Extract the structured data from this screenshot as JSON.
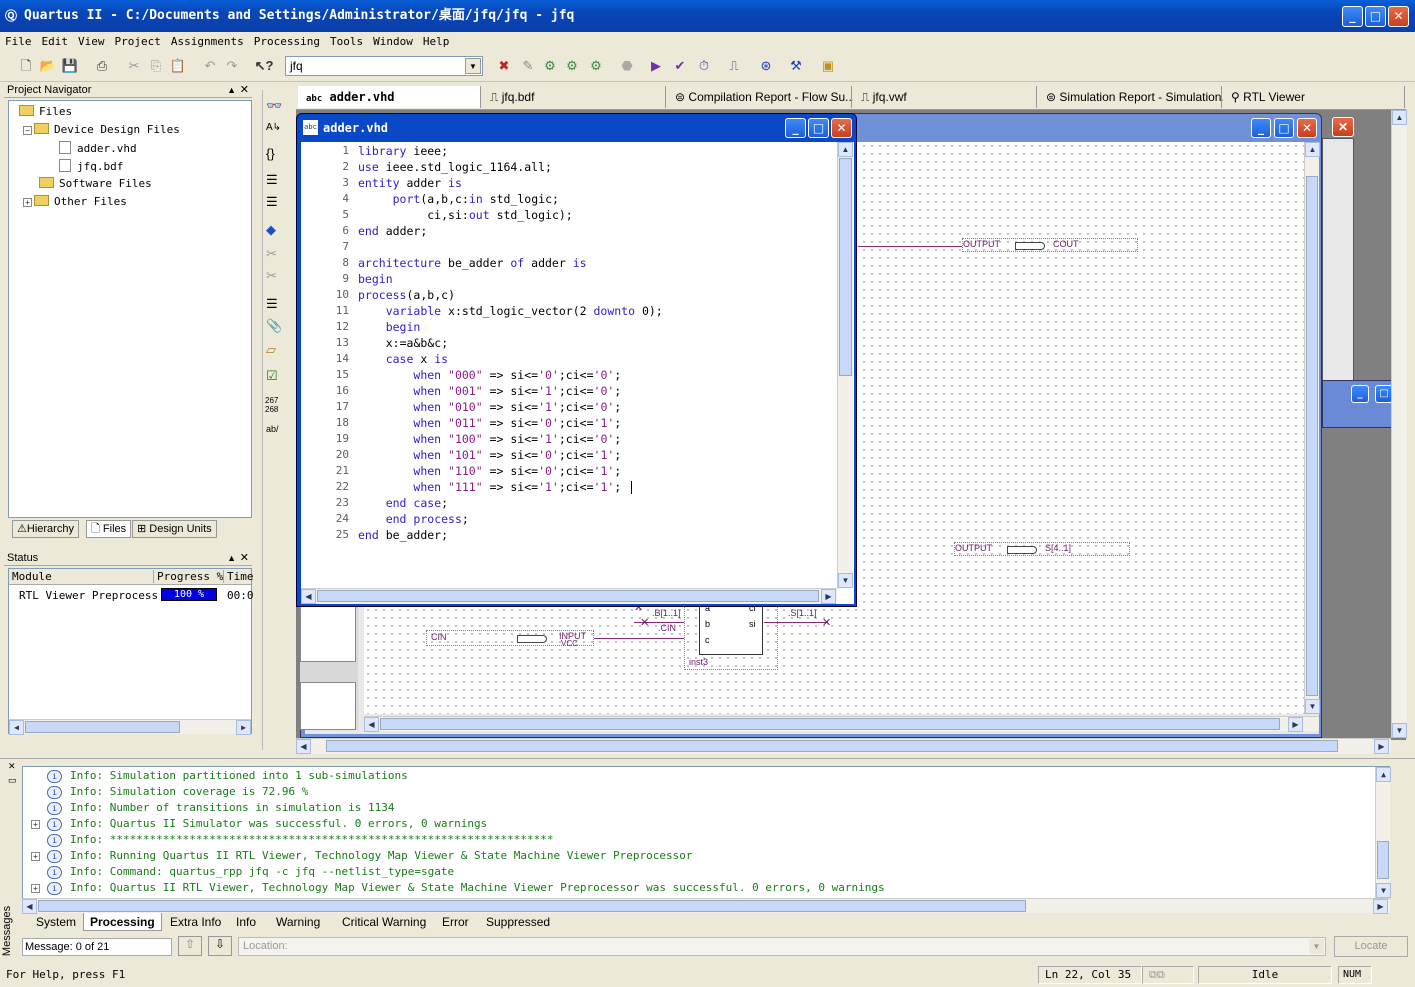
{
  "window": {
    "title": "Quartus II - C:/Documents and Settings/Administrator/桌面/jfq/jfq - jfq"
  },
  "menu": [
    "File",
    "Edit",
    "View",
    "Project",
    "Assignments",
    "Processing",
    "Tools",
    "Window",
    "Help"
  ],
  "toolbar": {
    "combo_value": "jfq"
  },
  "navigator": {
    "title": "Project Navigator",
    "tree": [
      "Files",
      "Device Design Files",
      "adder.vhd",
      "jfq.bdf",
      "Software Files",
      "Other Files"
    ],
    "tabs": [
      "Hierarchy",
      "Files",
      "Design Units"
    ]
  },
  "status_panel": {
    "title": "Status",
    "headers": [
      "Module",
      "Progress %",
      "Time"
    ],
    "row": {
      "module": "RTL Viewer Preprocess",
      "progress": "100 %",
      "time": "00:0"
    }
  },
  "doc_tabs": [
    "adder.vhd",
    "jfq.bdf",
    "Compilation Report - Flow Su...",
    "jfq.vwf",
    "Simulation Report - Simulation...",
    "RTL Viewer"
  ],
  "editor": {
    "title": "adder.vhd",
    "lines": [
      "library ieee;",
      "use ieee.std_logic_1164.all;",
      "entity adder is",
      "     port(a,b,c:in std_logic;",
      "          ci,si:out std_logic);",
      "end adder;",
      "",
      "architecture be_adder of adder is",
      "begin",
      "process(a,b,c)",
      "    variable x:std_logic_vector(2 downto 0);",
      "    begin",
      "    x:=a&b&c;",
      "    case x is",
      "        when \"000\" => si<='0';ci<='0';",
      "        when \"001\" => si<='1';ci<='0';",
      "        when \"010\" => si<='1';ci<='0';",
      "        when \"011\" => si<='0';ci<='1';",
      "        when \"100\" => si<='1';ci<='0';",
      "        when \"101\" => si<='0';ci<='1';",
      "        when \"110\" => si<='0';ci<='1';",
      "        when \"111\" => si<='1';ci<='1';",
      "    end case;",
      "    end process;",
      "end be_adder;"
    ]
  },
  "schematic": {
    "output_cout": "OUTPUT",
    "cout": "COUT",
    "output_s": "OUTPUT",
    "s": "S[4..1]",
    "input_label": "INPUT",
    "vcc": "VCC",
    "cin": "CIN",
    "b_wire": ".B[1..1]",
    "cin_wire": ".CIN",
    "s_wire": ".S[1..1]",
    "pin_a": "a",
    "pin_b": "b",
    "pin_c": "c",
    "pin_ci": "ci",
    "pin_si": "si",
    "inst": "inst3"
  },
  "messages": {
    "lines": [
      "Info: Simulation partitioned into 1 sub-simulations",
      "Info: Simulation coverage is      72.96 %",
      "Info: Number of transitions in simulation is 1134",
      "Info: Quartus II Simulator was successful. 0 errors, 0 warnings",
      "Info: *******************************************************************",
      "Info: Running Quartus II RTL Viewer, Technology Map Viewer & State Machine Viewer Preprocessor",
      "Info: Command: quartus_rpp jfq -c jfq --netlist_type=sgate",
      "Info: Quartus II RTL Viewer, Technology Map Viewer & State Machine Viewer Preprocessor was successful. 0 errors, 0 warnings"
    ],
    "tabs": [
      "System",
      "Processing",
      "Extra Info",
      "Info",
      "Warning",
      "Critical Warning",
      "Error",
      "Suppressed"
    ],
    "side_label": "Messages",
    "count": "Message: 0 of 21",
    "location_placeholder": "Location:",
    "locate": "Locate"
  },
  "statusbar": {
    "help": "For Help, press F1",
    "position": "Ln 22, Col 35",
    "state": "Idle",
    "num": "NUM"
  }
}
